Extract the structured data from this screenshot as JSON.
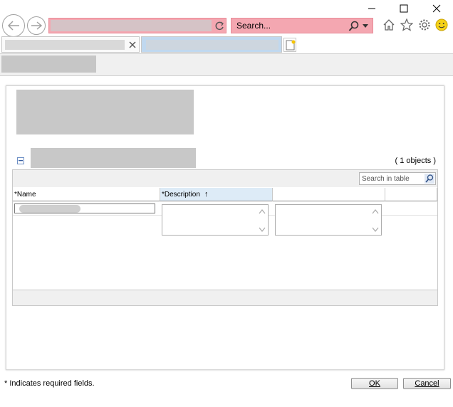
{
  "browser": {
    "search_placeholder": "Search...",
    "window_controls": [
      "minimize-icon",
      "maximize-icon",
      "close-icon"
    ],
    "toolbar_icons": [
      "home-icon",
      "star-icon",
      "gear-icon",
      "smiley-icon"
    ],
    "tabs": [
      {
        "label": "…",
        "active": true
      },
      {
        "label": "…",
        "active": false
      }
    ]
  },
  "dialog": {
    "object_count": "( 1 objects )",
    "table": {
      "search_placeholder": "Search in table",
      "columns": [
        {
          "label": "*Name",
          "sort": ""
        },
        {
          "label": "*Description",
          "sort": "↑"
        },
        {
          "label": "",
          "sort": ""
        },
        {
          "label": "",
          "sort": ""
        }
      ],
      "rows": [
        {
          "name": "",
          "description": "",
          "col3": ""
        }
      ]
    },
    "required_note": "* Indicates required fields.",
    "ok_label": "OK",
    "cancel_label": "Cancel"
  },
  "colors": {
    "address_bar": "#f4a7b1",
    "header_highlight": "#ddebf7",
    "redacted": "#c8c8c8"
  }
}
